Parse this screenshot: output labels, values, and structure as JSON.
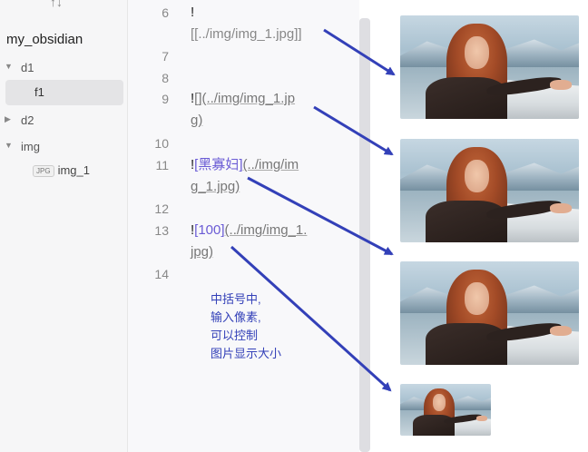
{
  "sidebar": {
    "sort_icon": "↑↓",
    "vault_name": "my_obsidian",
    "tree": {
      "d1": "d1",
      "f1": "f1",
      "d2": "d2",
      "img": "img",
      "img_badge": "JPG",
      "img_file": "img_1"
    }
  },
  "editor": {
    "lines": [
      {
        "no": "6",
        "bang": "!",
        "text": "[[../img/img_1.jpg]]"
      },
      {
        "no": "7"
      },
      {
        "no": "8"
      },
      {
        "no": "9",
        "bang": "!",
        "part1": "[](../img/img_1.jp",
        "part2": "g)"
      },
      {
        "no": "10"
      },
      {
        "no": "11",
        "bang": "!",
        "alt": "[黑寡妇]",
        "part1": "(../img/im",
        "part2": "g_1.jpg)"
      },
      {
        "no": "12"
      },
      {
        "no": "13",
        "bang": "!",
        "alt": "[100]",
        "part1": "(../img/img_1.",
        "part2": "jpg)"
      },
      {
        "no": "14"
      }
    ]
  },
  "annotation": {
    "lines": [
      "中括号中,",
      "输入像素,",
      "可以控制",
      "图片显示大小"
    ]
  },
  "colors": {
    "arrow": "#3340b8",
    "link": "#6a5bd5"
  }
}
